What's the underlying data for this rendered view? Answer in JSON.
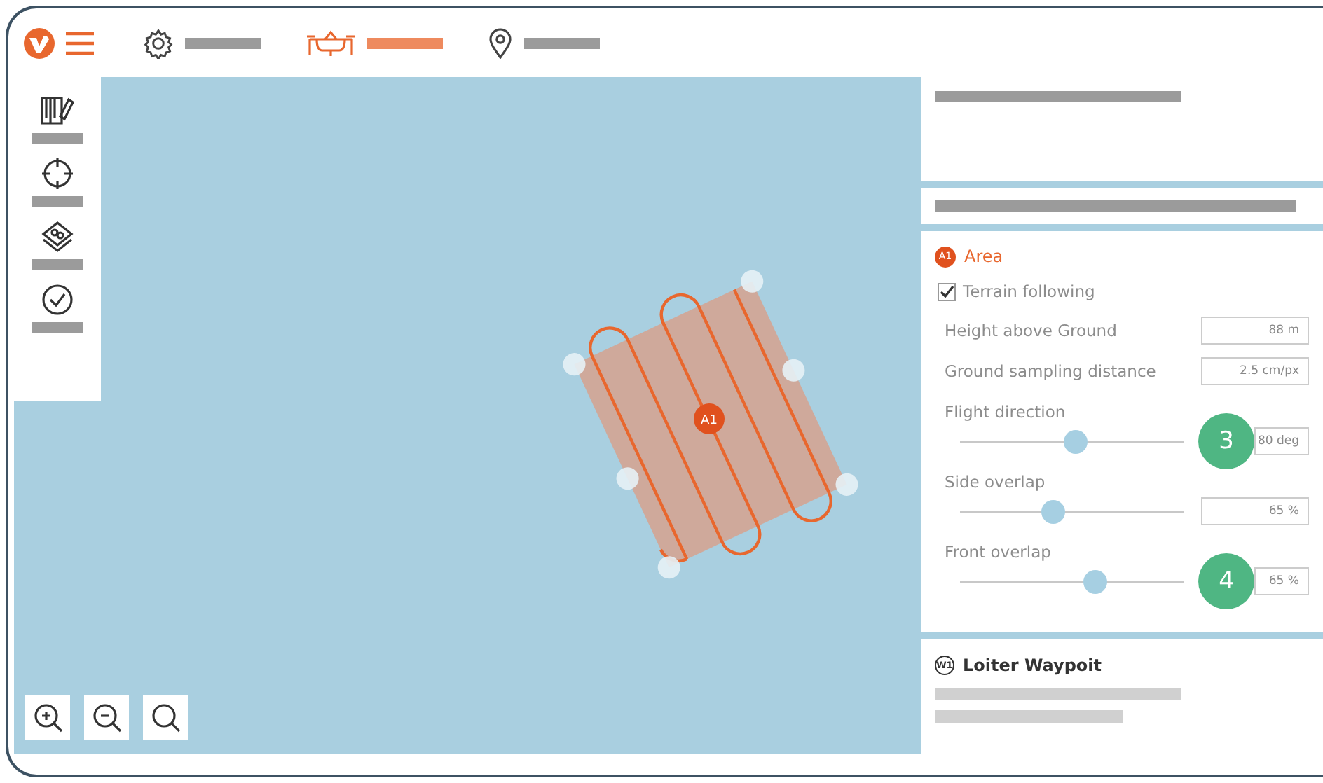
{
  "toolbar": {
    "tabs": [
      {
        "selected": false
      },
      {
        "selected": true
      },
      {
        "selected": false
      }
    ]
  },
  "map": {
    "area_marker": "A1"
  },
  "area_panel": {
    "badge": "A1",
    "title": "Area",
    "terrain_following": {
      "label": "Terrain following",
      "checked": true
    },
    "fields": [
      {
        "label": "Height above Ground",
        "value": "88 m"
      },
      {
        "label": "Ground sampling distance",
        "value": "2.5 cm/px"
      }
    ],
    "sliders": [
      {
        "label": "Flight direction",
        "level": 0.51,
        "value": "80 deg",
        "callout": "3"
      },
      {
        "label": "Side overlap",
        "level": 0.41,
        "value": "65 %"
      },
      {
        "label": "Front overlap",
        "level": 0.6,
        "value": "65 %",
        "callout": "4"
      }
    ]
  },
  "loiter_panel": {
    "badge": "W1",
    "title": "Loiter Waypoit"
  }
}
